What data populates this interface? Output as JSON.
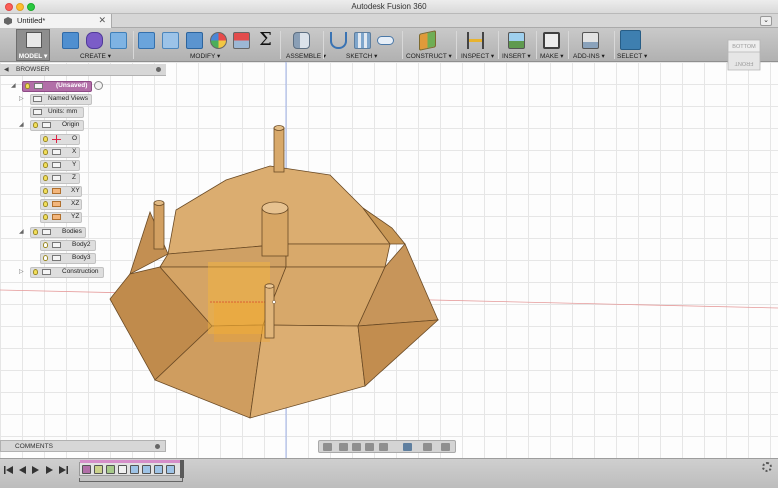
{
  "window": {
    "title": "Autodesk Fusion 360"
  },
  "tab": {
    "label": "Untitled*",
    "close": "✕",
    "overflow": "⌄"
  },
  "workspace": {
    "label": "MODEL ▾"
  },
  "toolbar_groups": [
    {
      "label": "CREATE ▾"
    },
    {
      "label": "MODIFY ▾"
    },
    {
      "label": "ASSEMBLE ▾"
    },
    {
      "label": "SKETCH ▾"
    },
    {
      "label": "CONSTRUCT ▾"
    },
    {
      "label": "INSPECT ▾"
    },
    {
      "label": "INSERT ▾"
    },
    {
      "label": "MAKE ▾"
    },
    {
      "label": "ADD-INS ▾"
    },
    {
      "label": "SELECT ▾"
    }
  ],
  "toolbar_icons": {
    "sum": "Σ"
  },
  "browser": {
    "title": "BROWSER",
    "root": "(Unsaved)",
    "named_views": "Named Views",
    "units": "Units: mm",
    "origin": "Origin",
    "origin_items": [
      "O",
      "X",
      "Y",
      "Z",
      "XY",
      "XZ",
      "YZ"
    ],
    "bodies": "Bodies",
    "body_items": [
      "Body2",
      "Body3"
    ],
    "construction": "Construction"
  },
  "comments": {
    "title": "COMMENTS"
  },
  "viewcube": {
    "top": "BOTTOM",
    "front": "FRONT"
  },
  "colors": {
    "wood_light": "#dcb074",
    "wood_mid": "#cc9a5c",
    "wood_dark": "#b98546",
    "select_highlight": "#f7b53a",
    "root_node": "#b26fa8",
    "select_button": "#3e7fb0"
  }
}
